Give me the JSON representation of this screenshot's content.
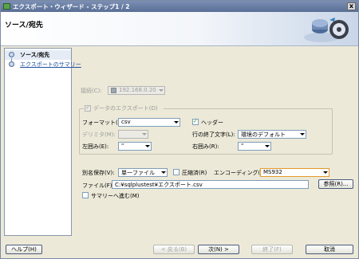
{
  "window": {
    "title": "エクスポート・ウィザード - ステップ1 / 2",
    "close_glyph": "x"
  },
  "header": {
    "title": "ソース/宛先"
  },
  "nav": {
    "items": [
      {
        "label": "ソース/宛先"
      },
      {
        "label": "エクスポートのサマリー"
      }
    ]
  },
  "form": {
    "connection_label": "接続(C):",
    "connection_value": "192.168.0.20",
    "data_export_label": "データのエクスポート(D)",
    "format_label": "フォーマット(F):",
    "format_value": "csv",
    "header_label": "ヘッダー",
    "delimiter_label": "デリミタ(M):",
    "line_terminator_label": "行の終了文字(L):",
    "line_terminator_value": "環境のデフォルト",
    "left_enclosure_label": "左囲み(E):",
    "left_enclosure_value": "\"",
    "right_enclosure_label": "右囲み(R):",
    "right_enclosure_value": "\"",
    "save_as_label": "別名保存(V):",
    "save_as_value": "単一ファイル",
    "compressed_label": "圧縮済(R)",
    "encoding_label": "エンコーディング(I):",
    "encoding_value": "MS932",
    "file_label": "ファイル(F):",
    "file_value": "C:¥sqlplustest¥エクスポート.csv",
    "browse_label": "参照(R)...",
    "summary_label": "サマリーへ進む(M)"
  },
  "footer": {
    "help_label": "ヘルプ(H)",
    "back_label": "< 戻る(B)",
    "next_label": "次(N) >",
    "finish_label": "終了(F)",
    "cancel_label": "取消"
  }
}
